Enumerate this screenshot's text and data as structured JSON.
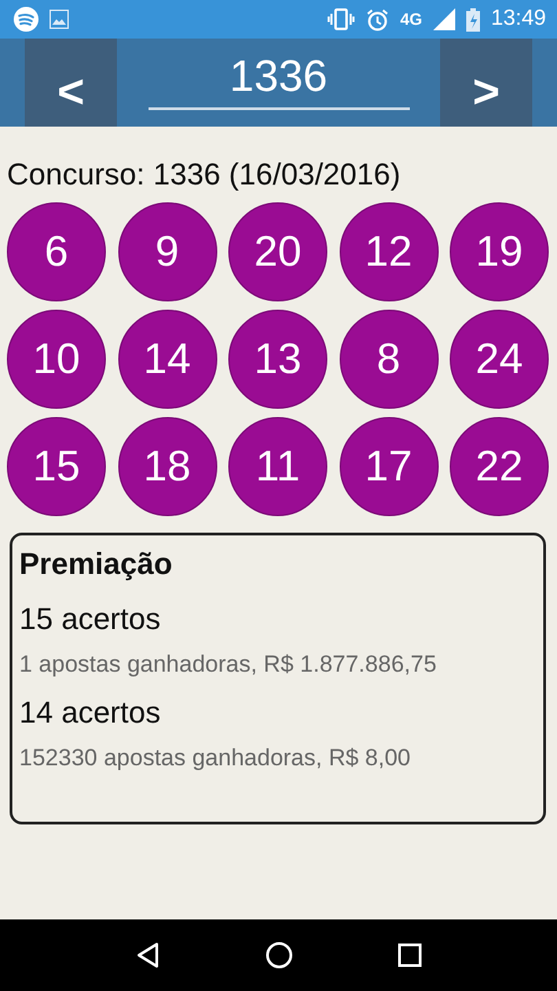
{
  "status_bar": {
    "network": "4G",
    "time": "13:49"
  },
  "header": {
    "prev_button": "<",
    "next_button": ">",
    "contest_number": "1336"
  },
  "contest_title": "Concurso: 1336 (16/03/2016)",
  "numbers": [
    "6",
    "9",
    "20",
    "12",
    "19",
    "10",
    "14",
    "13",
    "8",
    "24",
    "15",
    "18",
    "11",
    "17",
    "22"
  ],
  "prizes": {
    "title": "Premiação",
    "tiers": [
      {
        "hits": "15 acertos",
        "detail": "1 apostas ganhadoras, R$ 1.877.886,75"
      },
      {
        "hits": "14 acertos",
        "detail": "152330 apostas ganhadoras, R$ 8,00"
      }
    ]
  }
}
